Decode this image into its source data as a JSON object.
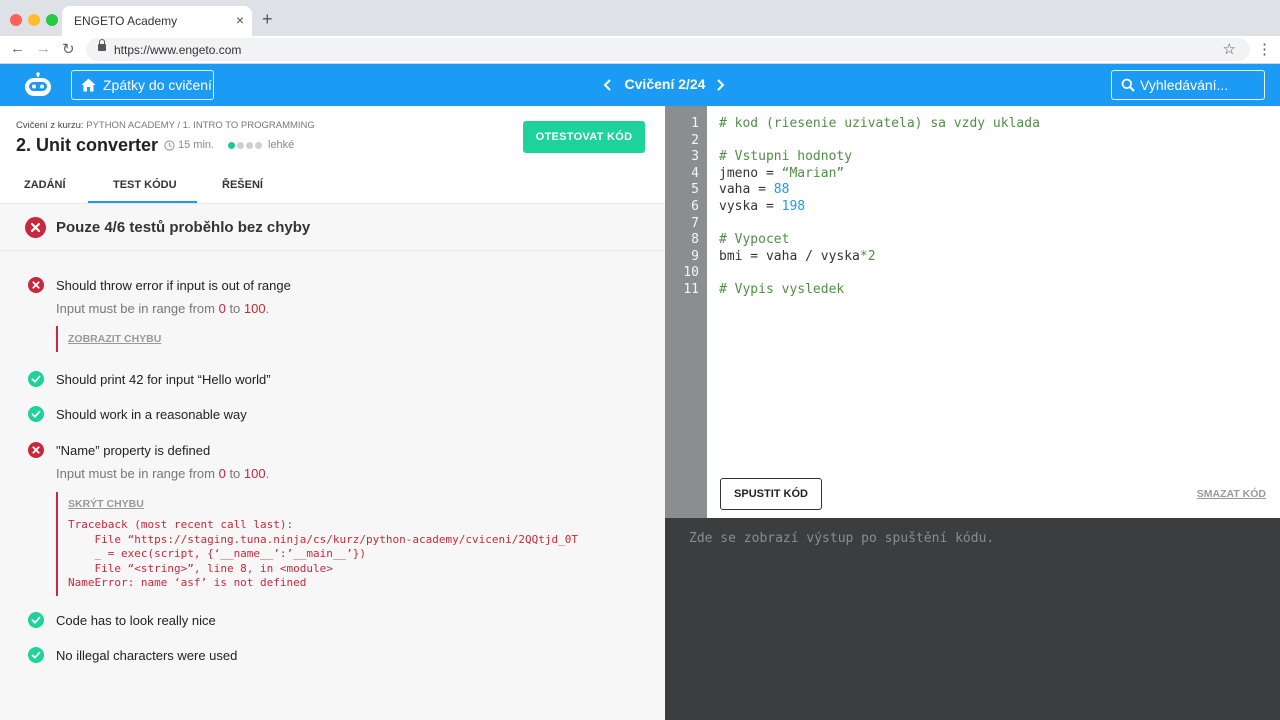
{
  "browser": {
    "tab_title": "ENGETO Academy",
    "tab_close": "×",
    "new_tab": "+",
    "url": "https://www.engeto.com",
    "back": "←",
    "forward": "→",
    "reload": "↻",
    "bookmark": "☆",
    "menu": "⋮"
  },
  "header": {
    "back_label": "Zpátky do cvičení",
    "exercise_nav": "Cvičení 2/24",
    "search_placeholder": "Vyhledávání...",
    "accent_color": "#1c9bf5"
  },
  "exercise": {
    "course_prefix": "Cvičení z kurzu:",
    "course_path": "PYTHON ACADEMY / 1. INTRO TO PROGRAMMING",
    "title": "2. Unit converter",
    "duration": "15 min.",
    "difficulty_level": 1,
    "difficulty_max": 4,
    "difficulty_label": "lehké",
    "test_button": "OTESTOVAT KÓD"
  },
  "tabs": [
    {
      "label": "ZADÁNÍ"
    },
    {
      "label": "TEST KÓDU",
      "active": true
    },
    {
      "label": "ŘEŠENÍ"
    }
  ],
  "results": {
    "summary": "Pouze 4/6 testů proběhlo bez chyby",
    "error_color": "#c7283c",
    "success_color": "#1dd39a",
    "tests": [
      {
        "status": "fail",
        "name": "Should throw error if input is out of range",
        "msg_prefix": "Input must be in range from ",
        "msg_from": "0",
        "msg_mid": " to ",
        "msg_to": "100",
        "msg_suffix": ".",
        "toggle": "ZOBRAZIT CHYBU"
      },
      {
        "status": "pass",
        "name": "Should print 42 for input “Hello world”"
      },
      {
        "status": "pass",
        "name": "Should work in a reasonable way"
      },
      {
        "status": "fail",
        "name": "\"Name” property is defined",
        "msg_prefix": "Input must be in range from ",
        "msg_from": "0",
        "msg_mid": " to ",
        "msg_to": "100",
        "msg_suffix": ".",
        "toggle": "SKRÝT CHYBU",
        "traceback": [
          "Traceback (most recent call last):",
          "    File “https://staging.tuna.ninja/cs/kurz/python-academy/cviceni/2QQtjd_0T",
          "    _ = exec(script, {‘__name__’:’__main__’})",
          "    File “<string>”, line 8, in <module>",
          "NameError: name ‘asf’ is not defined"
        ]
      },
      {
        "status": "pass",
        "name": "Code has to look really nice"
      },
      {
        "status": "pass",
        "name": "No illegal characters were used"
      }
    ]
  },
  "editor": {
    "lines": [
      {
        "num": "1",
        "tokens": [
          {
            "t": "c",
            "v": "# kod (riesenie uzivatela) sa vzdy uklada"
          }
        ]
      },
      {
        "num": "2",
        "tokens": []
      },
      {
        "num": "3",
        "tokens": [
          {
            "t": "c",
            "v": "# Vstupni hodnoty"
          }
        ]
      },
      {
        "num": "4",
        "tokens": [
          {
            "t": "p",
            "v": "jmeno = "
          },
          {
            "t": "s",
            "v": "“Marian”"
          }
        ]
      },
      {
        "num": "5",
        "tokens": [
          {
            "t": "p",
            "v": "vaha = "
          },
          {
            "t": "n",
            "v": "88"
          }
        ]
      },
      {
        "num": "6",
        "tokens": [
          {
            "t": "p",
            "v": "vyska = "
          },
          {
            "t": "n",
            "v": "198"
          }
        ]
      },
      {
        "num": "7",
        "tokens": []
      },
      {
        "num": "8",
        "tokens": [
          {
            "t": "c",
            "v": "# Vypocet"
          }
        ]
      },
      {
        "num": "9",
        "tokens": [
          {
            "t": "p",
            "v": "bmi = vaha / vyska"
          },
          {
            "t": "o",
            "v": "*2"
          }
        ]
      },
      {
        "num": "10",
        "tokens": []
      },
      {
        "num": "11",
        "tokens": [
          {
            "t": "c",
            "v": "# Vypis vysledek"
          }
        ]
      }
    ],
    "run_button": "SPUSTIT KÓD",
    "clear_link": "SMAZAT KÓD"
  },
  "console": {
    "placeholder": "Zde se zobrazí výstup po spuštění kódu."
  }
}
